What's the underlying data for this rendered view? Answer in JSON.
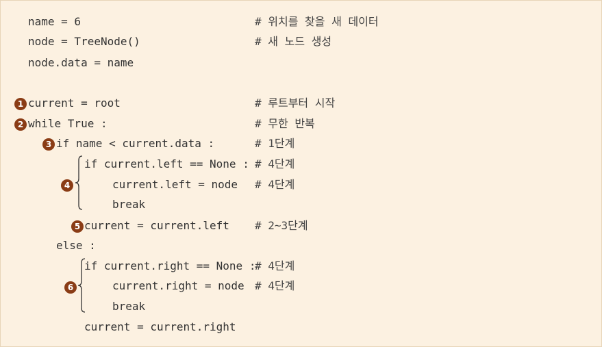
{
  "lines": [
    {
      "code": "name = 6",
      "comment": "# 위치를 찾을 새 데이터"
    },
    {
      "code": "node = TreeNode()",
      "comment": "# 새 노드 생성"
    },
    {
      "code": "node.data = name",
      "comment": ""
    },
    {
      "code": "current = root",
      "comment": "# 루트부터 시작"
    },
    {
      "code": "while True :",
      "comment": "# 무한 반복"
    },
    {
      "code": "if name < current.data :",
      "comment": "# 1단계"
    },
    {
      "code": "if current.left == None :",
      "comment": "# 4단계"
    },
    {
      "code": "current.left = node",
      "comment": "# 4단계"
    },
    {
      "code": "break",
      "comment": ""
    },
    {
      "code": "current = current.left",
      "comment": "# 2~3단계"
    },
    {
      "code": "else :",
      "comment": ""
    },
    {
      "code": "if current.right == None :",
      "comment": "# 4단계"
    },
    {
      "code": "current.right = node",
      "comment": "# 4단계"
    },
    {
      "code": "break",
      "comment": ""
    },
    {
      "code": "current = current.right",
      "comment": ""
    }
  ],
  "markers": [
    "1",
    "2",
    "3",
    "4",
    "5",
    "6"
  ],
  "colors": {
    "background": "#fcf1e1",
    "marker": "#8a3c15",
    "text": "#333333"
  }
}
